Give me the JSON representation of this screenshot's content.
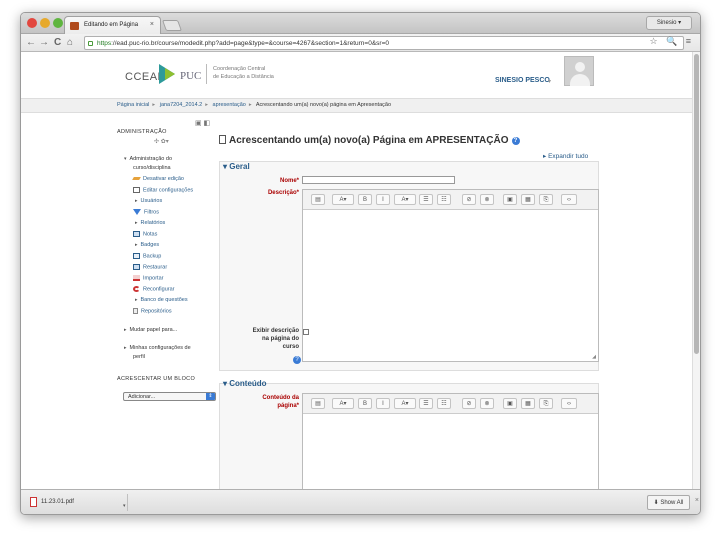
{
  "browser": {
    "tab_title": "Editando em Página",
    "tab_close": "×",
    "user_button": "Sinesio",
    "url_scheme": "https",
    "url_rest": "://ead.puc-rio.br/course/modedit.php?add=page&type=&course=4267&section=1&return=0&sr=0",
    "nav": {
      "back": "←",
      "forward": "→",
      "reload": "C",
      "home": "⌂"
    },
    "toolbar_icons": "☆ 🔍 ≡"
  },
  "site": {
    "logo_text": "CCEAD",
    "logo_puc": "PUC",
    "tagline_line1": "Coordenação Central",
    "tagline_line2": "de Educação a Distância",
    "user_name": "SINESIO PESCO",
    "user_caret": "▾"
  },
  "breadcrumb": [
    "Página inicial",
    "jana7204_2014.2",
    "apresentação",
    "Acrescentando um(a) novo(a) página em Apresentação"
  ],
  "admin": {
    "title": "ADMINISTRAÇÃO",
    "controls": "▣ ◧",
    "move": "✣ ✿▾",
    "items": [
      {
        "label": "Administração do",
        "label2": "curso/disciplina",
        "icon": "chevron-down-icon",
        "plain": true
      },
      {
        "label": "Desativar edição",
        "icon": "pencil-icon"
      },
      {
        "label": "Editar configurações",
        "icon": "settings-icon"
      },
      {
        "label": "Usuários",
        "icon": "chevron-right-icon"
      },
      {
        "label": "Filtros",
        "icon": "filter-icon"
      },
      {
        "label": "Relatórios",
        "icon": "chevron-right-icon"
      },
      {
        "label": "Notas",
        "icon": "grades-icon"
      },
      {
        "label": "Badges",
        "icon": "chevron-right-icon"
      },
      {
        "label": "Backup",
        "icon": "backup-icon"
      },
      {
        "label": "Restaurar",
        "icon": "restore-icon"
      },
      {
        "label": "Importar",
        "icon": "import-icon"
      },
      {
        "label": "Reconfigurar",
        "icon": "reset-icon"
      },
      {
        "label": "Banco de questões",
        "icon": "chevron-right-icon"
      },
      {
        "label": "Repositórios",
        "icon": "repository-icon"
      }
    ],
    "switch_role": "Mudar papel para...",
    "profile_settings_1": "Minhas configurações de",
    "profile_settings_2": "perfil"
  },
  "add_block": {
    "title": "ACRESCENTAR UM BLOCO",
    "select_value": "Adicionar...",
    "select_button": "⇕"
  },
  "main": {
    "title": "Acrescentando um(a) novo(a) Página em APRESENTAÇÃO",
    "help": "?",
    "expand_all": "▸ Expandir tudo",
    "general_legend": "▾ Geral",
    "name_label": "Nome*",
    "description_label": "Descrição*",
    "show_description_1": "Exibir descrição",
    "show_description_2": "na página do",
    "show_description_3": "curso",
    "content_legend": "▾ Conteúdo",
    "page_content_1": "Conteúdo da",
    "page_content_2": "página*",
    "toolbar_buttons": [
      {
        "name": "toggle-toolbar-button",
        "text": "▤"
      },
      {
        "name": "font-family-button",
        "text": "A▾"
      },
      {
        "name": "bold-button",
        "text": "B"
      },
      {
        "name": "italic-button",
        "text": "I"
      },
      {
        "name": "format-button",
        "text": "A▾"
      },
      {
        "name": "bullet-list-button",
        "text": "☰"
      },
      {
        "name": "numbered-list-button",
        "text": "☷"
      },
      {
        "name": "link-button",
        "text": "⊘"
      },
      {
        "name": "unlink-button",
        "text": "⊗"
      },
      {
        "name": "image-button",
        "text": "▣"
      },
      {
        "name": "media-button",
        "text": "▦"
      },
      {
        "name": "file-button",
        "text": "⎘"
      },
      {
        "name": "html-button",
        "text": "‹›"
      }
    ],
    "resize_grip": "◢"
  },
  "downloads": {
    "file_name": "11.23.01.pdf",
    "menu_arrow": "▾",
    "show_all": "⬇ Show All",
    "close": "×"
  }
}
